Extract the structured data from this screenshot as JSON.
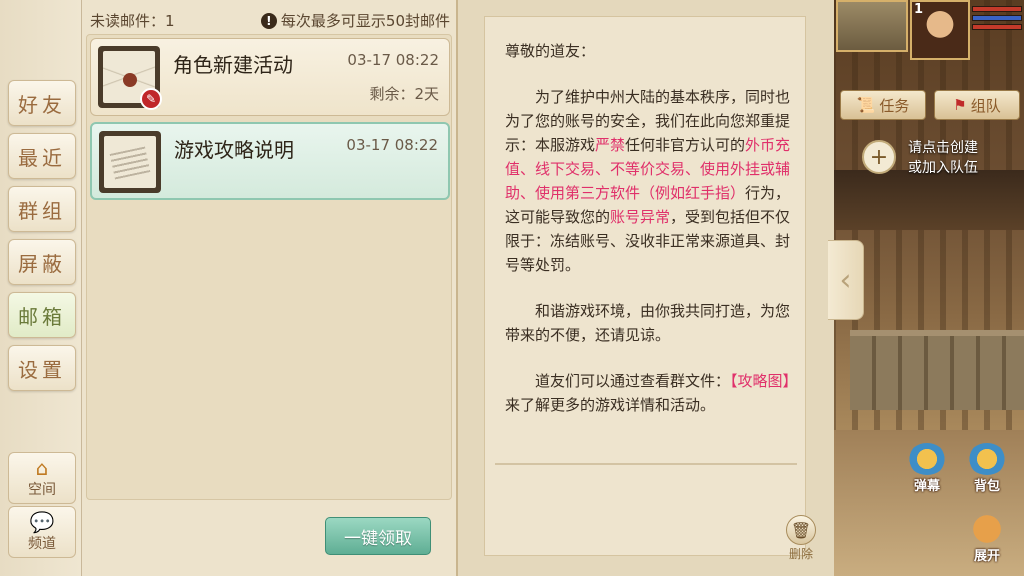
{
  "tabs": [
    {
      "label": "好友"
    },
    {
      "label": "最近"
    },
    {
      "label": "群组"
    },
    {
      "label": "屏蔽"
    },
    {
      "label": "邮箱",
      "active": true
    },
    {
      "label": "设置"
    }
  ],
  "bottom_buttons": [
    {
      "label": "空间",
      "icon": "house-icon"
    },
    {
      "label": "频道",
      "icon": "chat-bubble-icon"
    }
  ],
  "mail_header": {
    "unread": "未读邮件：1",
    "limit": "每次最多可显示50封邮件"
  },
  "mails": [
    {
      "title": "角色新建活动",
      "time": "03-17 08:22",
      "remain": "剩余：2天",
      "has_attachment": true
    },
    {
      "title": "游戏攻略说明",
      "time": "03-17 08:22",
      "remain": "",
      "selected": true
    }
  ],
  "claim_all_label": "一键领取",
  "letter": {
    "greeting": "尊敬的道友：",
    "p1_a": "为了维护中州大陆的基本秩序，同时也为了您的账号的安全，我们在此向您郑重提示：本服游戏",
    "p1_hl1": "严禁",
    "p1_b": "任何非官方认可的",
    "p1_hl2": "外币充值、线下交易、不等价交易、使用外挂或辅助、使用第三方软件（例如红手指）",
    "p1_c": "行为，这可能导致您的",
    "p1_hl3": "账号异常",
    "p1_d": "，受到包括但不仅限于：冻结账号、没收非正常来源道具、封号等处罚。",
    "p2": "和谐游戏环境，由你我共同打造，为您带来的不便，还请见谅。",
    "p3_a": "道友们可以通过查看群文件：",
    "p3_hl": "【攻略图】",
    "p3_b": "来了解更多的游戏详情和活动。"
  },
  "delete_label": "删除",
  "hud": {
    "level": "1",
    "task_label": "任务",
    "team_label": "组队",
    "team_hint_line1": "请点击创建",
    "team_hint_line2": "或加入队伍",
    "icons": [
      {
        "label": "弹幕",
        "icon": "danmaku-icon"
      },
      {
        "label": "背包",
        "icon": "backpack-icon"
      },
      {
        "label": "展开",
        "icon": "expand-icon"
      }
    ]
  },
  "colors": {
    "highlight": "#e0306a",
    "active_tab": "#6a7a3a",
    "claim_button": "#5fae94"
  }
}
